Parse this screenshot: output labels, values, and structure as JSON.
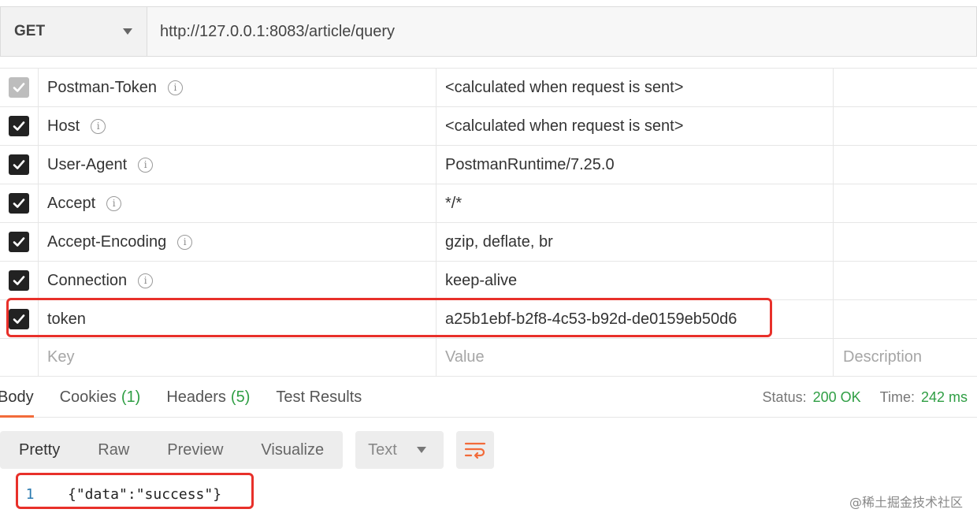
{
  "request": {
    "method": "GET",
    "url": "http://127.0.0.1:8083/article/query"
  },
  "headers": {
    "rows": [
      {
        "key": "Postman-Token",
        "value": "<calculated when request is sent>",
        "checked": true,
        "disabled": true
      },
      {
        "key": "Host",
        "value": "<calculated when request is sent>",
        "checked": true,
        "disabled": false
      },
      {
        "key": "User-Agent",
        "value": "PostmanRuntime/7.25.0",
        "checked": true,
        "disabled": false
      },
      {
        "key": "Accept",
        "value": "*/*",
        "checked": true,
        "disabled": false
      },
      {
        "key": "Accept-Encoding",
        "value": "gzip, deflate, br",
        "checked": true,
        "disabled": false
      },
      {
        "key": "Connection",
        "value": "keep-alive",
        "checked": true,
        "disabled": false
      },
      {
        "key": "token",
        "value": "a25b1ebf-b2f8-4c53-b92d-de0159eb50d6",
        "checked": true,
        "disabled": false
      }
    ],
    "placeholders": {
      "key": "Key",
      "value": "Value",
      "description": "Description"
    },
    "info_glyph": "i"
  },
  "response": {
    "tabs": {
      "body": "Body",
      "cookies": "Cookies",
      "cookies_count": "(1)",
      "headers": "Headers",
      "headers_count": "(5)",
      "tests": "Test Results"
    },
    "status_label": "Status:",
    "status_value": "200 OK",
    "time_label": "Time:",
    "time_value": "242 ms",
    "view_modes": {
      "pretty": "Pretty",
      "raw": "Raw",
      "preview": "Preview",
      "visualize": "Visualize"
    },
    "format": "Text",
    "code": {
      "line_number": "1",
      "text": "{\"data\":\"success\"}"
    }
  },
  "watermark": "@稀土掘金技术社区",
  "colors": {
    "accent": "#f26b3a",
    "success": "#2f9e44",
    "highlight": "#e8302a"
  }
}
